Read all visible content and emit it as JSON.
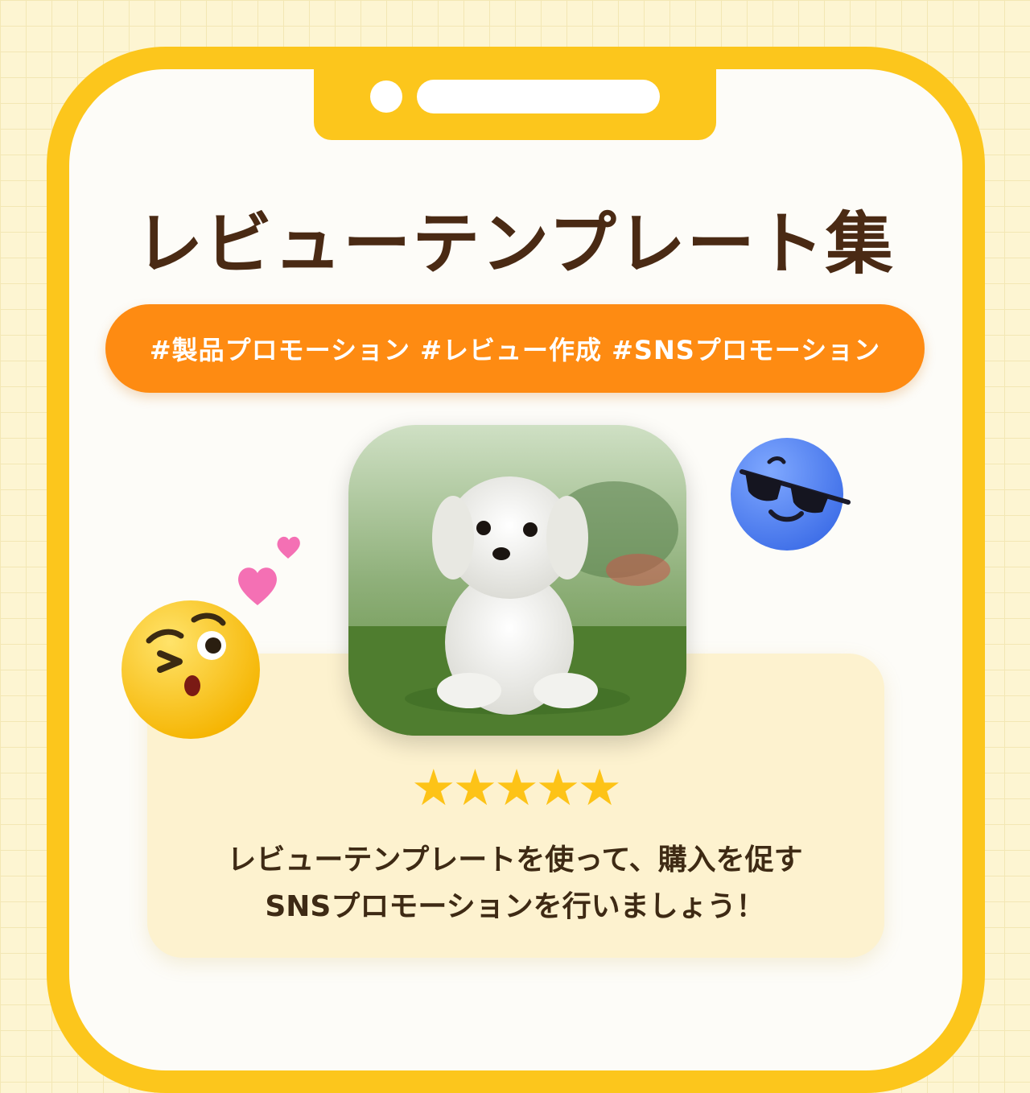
{
  "title": "レビューテンプレート集",
  "tags": "#製品プロモーション #レビュー作成 #SNSプロモーション",
  "rating": {
    "stars": 5,
    "display": "★★★★★",
    "color": "#fdc317"
  },
  "message": {
    "line1": "レビューテンプレートを使って、購入を促す",
    "line2": "SNSプロモーションを行いましょう！"
  },
  "colors": {
    "frame": "#fcc61c",
    "tag_pill": "#fe8b12",
    "title_text": "#4a2a14",
    "card": "#fdf2cf"
  },
  "decorations": [
    "wink-emoji-icon",
    "sunglasses-emoji-icon",
    "hearts-icon",
    "puppy-photo"
  ]
}
